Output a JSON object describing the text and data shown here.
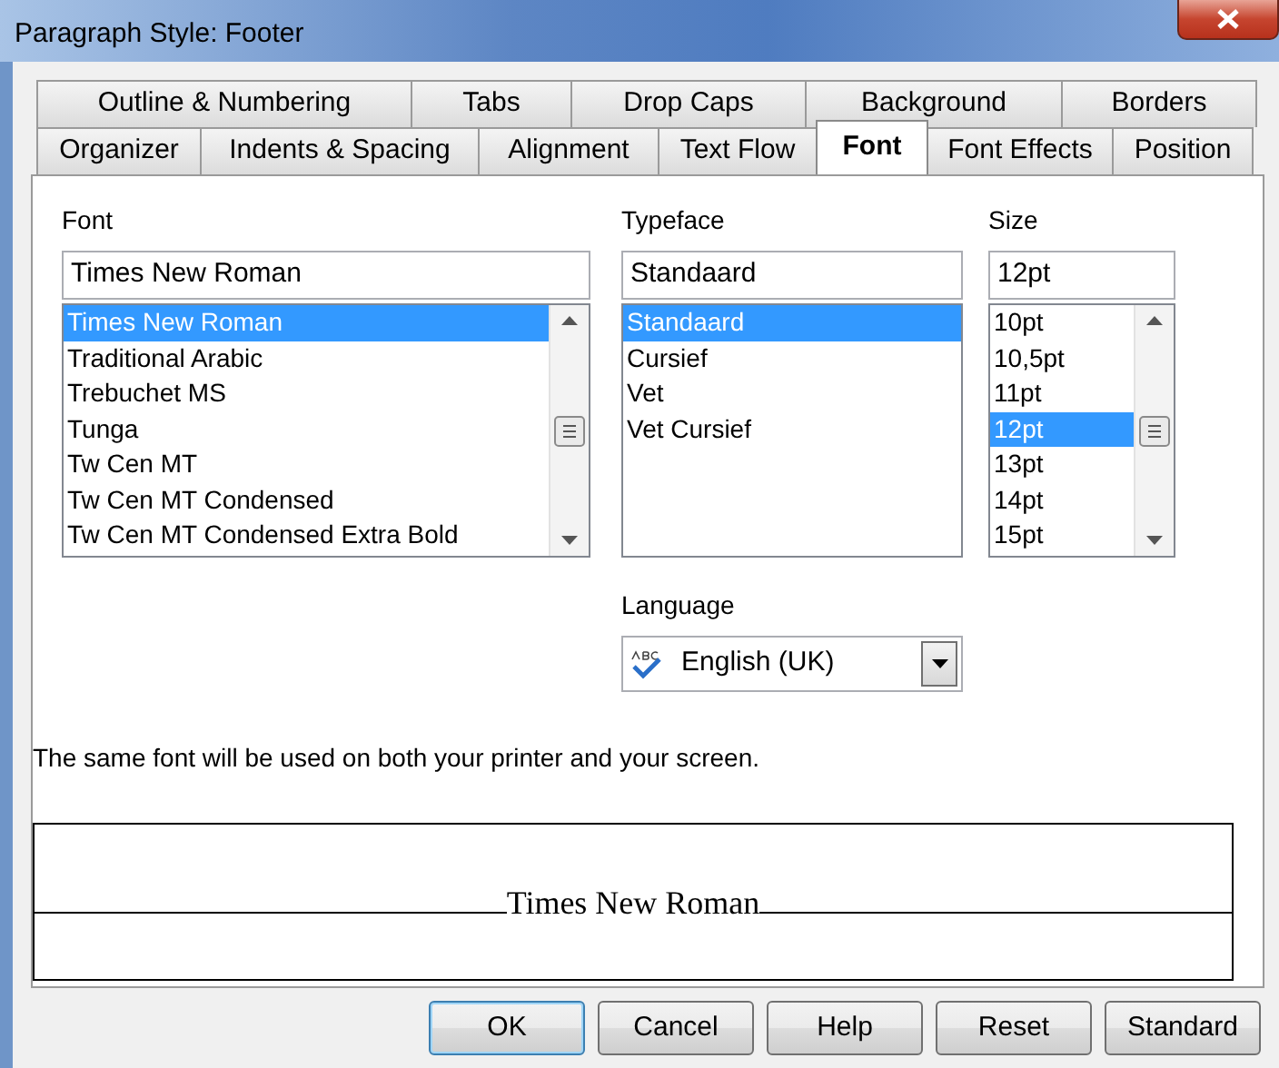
{
  "window": {
    "title": "Paragraph Style: Footer"
  },
  "tab_rows": [
    {
      "tabs": [
        {
          "label": "Outline & Numbering",
          "selected": false
        },
        {
          "label": "Tabs",
          "selected": false
        },
        {
          "label": "Drop Caps",
          "selected": false
        },
        {
          "label": "Background",
          "selected": false
        },
        {
          "label": "Borders",
          "selected": false
        }
      ]
    },
    {
      "tabs": [
        {
          "label": "Organizer",
          "selected": false
        },
        {
          "label": "Indents & Spacing",
          "selected": false
        },
        {
          "label": "Alignment",
          "selected": false
        },
        {
          "label": "Text Flow",
          "selected": false
        },
        {
          "label": "Font",
          "selected": true
        },
        {
          "label": "Font Effects",
          "selected": false
        },
        {
          "label": "Position",
          "selected": false
        }
      ]
    }
  ],
  "font": {
    "label": "Font",
    "value": "Times New Roman",
    "options": [
      {
        "label": "Times New Roman",
        "selected": true
      },
      {
        "label": "Traditional Arabic",
        "selected": false
      },
      {
        "label": "Trebuchet MS",
        "selected": false
      },
      {
        "label": "Tunga",
        "selected": false
      },
      {
        "label": "Tw Cen MT",
        "selected": false
      },
      {
        "label": "Tw Cen MT Condensed",
        "selected": false
      },
      {
        "label": "Tw Cen MT Condensed Extra Bold",
        "selected": false
      }
    ]
  },
  "typeface": {
    "label": "Typeface",
    "value": "Standaard",
    "options": [
      {
        "label": "Standaard",
        "selected": true
      },
      {
        "label": "Cursief",
        "selected": false
      },
      {
        "label": "Vet",
        "selected": false
      },
      {
        "label": "Vet Cursief",
        "selected": false
      }
    ]
  },
  "size": {
    "label": "Size",
    "value": "12pt",
    "options": [
      {
        "label": "10pt",
        "selected": false
      },
      {
        "label": "10,5pt",
        "selected": false
      },
      {
        "label": "11pt",
        "selected": false
      },
      {
        "label": "12pt",
        "selected": true
      },
      {
        "label": "13pt",
        "selected": false
      },
      {
        "label": "14pt",
        "selected": false
      },
      {
        "label": "15pt",
        "selected": false
      }
    ]
  },
  "language": {
    "label": "Language",
    "value": "English (UK)"
  },
  "note": "The same font will be used on both your printer and your screen.",
  "preview": {
    "text": "Times New Roman"
  },
  "buttons": [
    {
      "label": "OK",
      "default": true
    },
    {
      "label": "Cancel",
      "default": false
    },
    {
      "label": "Help",
      "default": false
    },
    {
      "label": "Reset",
      "default": false
    },
    {
      "label": "Standard",
      "default": false
    }
  ]
}
